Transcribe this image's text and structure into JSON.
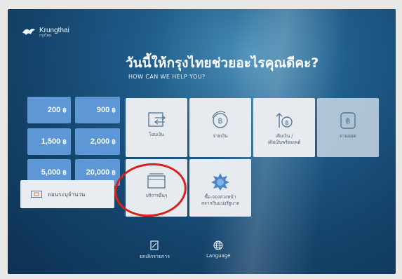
{
  "brand": {
    "name_en": "Krungthai",
    "name_th": "กรุงไทย"
  },
  "header": {
    "title_th": "วันนี้ให้กรุงไทยช่วยอะไรคุณดีคะ?",
    "title_en": "HOW CAN WE HELP YOU?"
  },
  "amounts": [
    {
      "value": "200",
      "currency": "฿"
    },
    {
      "value": "900",
      "currency": "฿"
    },
    {
      "value": "1,500",
      "currency": "฿"
    },
    {
      "value": "2,000",
      "currency": "฿"
    },
    {
      "value": "5,000",
      "currency": "฿"
    },
    {
      "value": "20,000",
      "currency": "฿"
    }
  ],
  "other_amount": {
    "label": "ถอนระบุจำนวน"
  },
  "services": [
    {
      "label": "โอนเงิน",
      "icon": "transfer-icon"
    },
    {
      "label": "จ่ายเงิน",
      "icon": "pay-icon"
    },
    {
      "label": "เติมเงิน /",
      "label2": "เติมเงินพร้อมเพย์",
      "icon": "topup-icon"
    },
    {
      "label": "ถามยอด",
      "icon": "balance-icon"
    },
    {
      "label": "บริการอื่นๆ",
      "icon": "other-services-icon"
    },
    {
      "label": "ซื้อ-จองล่วงหน้า",
      "label2": "สลากกินแบ่งรัฐบาล",
      "icon": "lottery-icon"
    }
  ],
  "bottom": {
    "cancel_label": "ยกเลิกรายการ",
    "language_label": "Language"
  },
  "colors": {
    "screen_bg": "#14446c",
    "amount_tile": "#5d97d6",
    "highlight_circle": "#d8201e"
  }
}
